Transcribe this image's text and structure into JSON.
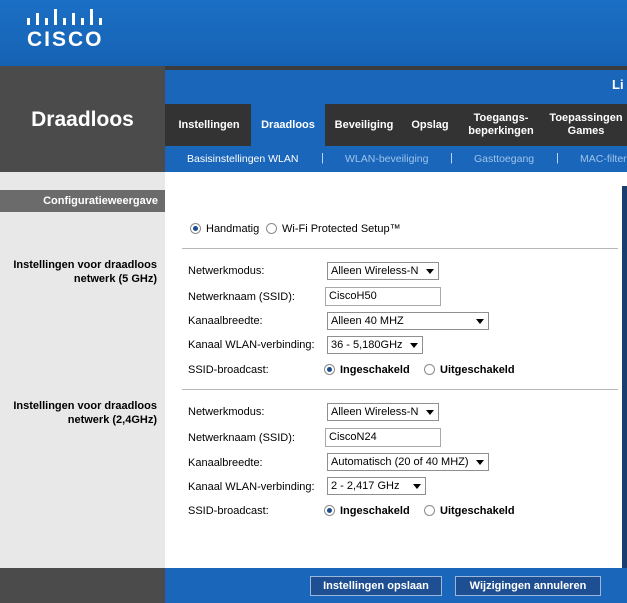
{
  "header": {
    "logo_text": "CISCO",
    "strip_text": "Li"
  },
  "section_title": "Draadloos",
  "tabs": [
    {
      "label": "Instellingen"
    },
    {
      "label": "Draadloos"
    },
    {
      "label": "Beveiliging"
    },
    {
      "label": "Opslag"
    },
    {
      "label": "Toegangs-beperkingen"
    },
    {
      "label": "Toepassingen Games"
    }
  ],
  "subnav": [
    {
      "label": "Basisinstellingen WLAN"
    },
    {
      "label": "WLAN-beveiliging"
    },
    {
      "label": "Gasttoegang"
    },
    {
      "label": "MAC-filter"
    }
  ],
  "sidebar": {
    "config_view": "Configuratieweergave",
    "section_5ghz": "Instellingen voor draadloos netwerk (5 GHz)",
    "section_24ghz": "Instellingen voor draadloos netwerk (2,4GHz)"
  },
  "setup_mode": {
    "manual": "Handmatig",
    "wps": "Wi-Fi Protected Setup™",
    "selected": "Handmatig"
  },
  "net5": {
    "mode_label": "Netwerkmodus:",
    "mode_value": "Alleen Wireless-N",
    "ssid_label": "Netwerknaam (SSID):",
    "ssid_value": "CiscoH50",
    "width_label": "Kanaalbreedte:",
    "width_value": "Alleen 40 MHZ",
    "channel_label": "Kanaal WLAN-verbinding:",
    "channel_value": "36 - 5,180GHz",
    "broadcast_label": "SSID-broadcast:",
    "on_label": "Ingeschakeld",
    "off_label": "Uitgeschakeld",
    "broadcast_selected": "Ingeschakeld"
  },
  "net24": {
    "mode_label": "Netwerkmodus:",
    "mode_value": "Alleen Wireless-N",
    "ssid_label": "Netwerknaam (SSID):",
    "ssid_value": "CiscoN24",
    "width_label": "Kanaalbreedte:",
    "width_value": "Automatisch (20 of 40 MHZ)",
    "channel_label": "Kanaal WLAN-verbinding:",
    "channel_value": "2 - 2,417 GHz",
    "broadcast_label": "SSID-broadcast:",
    "on_label": "Ingeschakeld",
    "off_label": "Uitgeschakeld",
    "broadcast_selected": "Ingeschakeld"
  },
  "footer": {
    "save": "Instellingen opslaan",
    "cancel": "Wijzigingen annuleren"
  },
  "colors": {
    "brand_blue": "#1a66bb",
    "dark_gray": "#4b4b4b"
  }
}
